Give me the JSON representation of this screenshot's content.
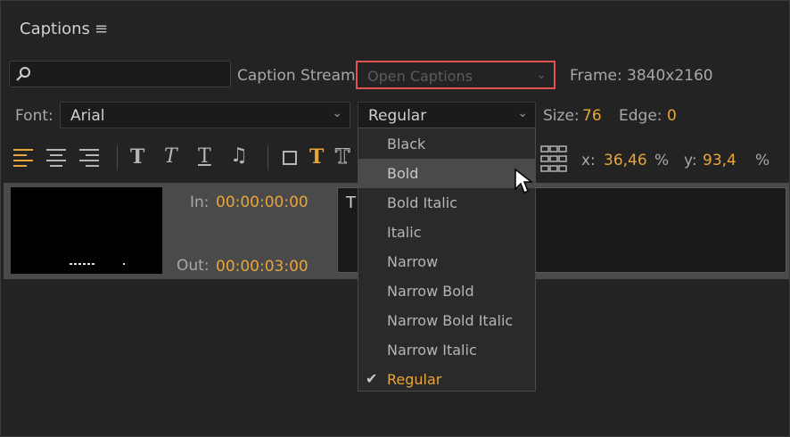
{
  "panel": {
    "title": "Captions",
    "menu_icon": "hamburger-icon"
  },
  "search": {
    "icon": "search-icon",
    "value": ""
  },
  "caption_stream": {
    "label": "Caption Stream:",
    "value": "Open Captions"
  },
  "frame": {
    "label": "Frame:",
    "value": "3840x2160"
  },
  "font": {
    "label": "Font:",
    "value": "Arial"
  },
  "style": {
    "value": "Regular"
  },
  "size": {
    "label": "Size:",
    "value": "76"
  },
  "edge": {
    "label": "Edge:",
    "value": "0"
  },
  "position": {
    "x_label": "x:",
    "x_value": "36,46",
    "x_unit": "%",
    "y_label": "y:",
    "y_value": "93,4",
    "y_unit": "%"
  },
  "toolbar": {
    "bold_glyph": "T",
    "italic_glyph": "T",
    "underline_glyph": "T",
    "text_color_glyph": "T",
    "outline_glyph": "T",
    "music_glyph": "♫"
  },
  "caption": {
    "in_label": "In:",
    "in_time": "00:00:00:00",
    "out_label": "Out:",
    "out_time": "00:00:03:00",
    "text": "T"
  },
  "style_dropdown": {
    "items": [
      "Black",
      "Bold",
      "Bold Italic",
      "Italic",
      "Narrow",
      "Narrow Bold",
      "Narrow Bold Italic",
      "Narrow Italic",
      "Regular"
    ],
    "hovered": "Bold",
    "selected": "Regular",
    "check_glyph": "✔"
  },
  "colors": {
    "accent": "#e8a53a",
    "highlight_border": "#e05353",
    "background": "#232323"
  }
}
